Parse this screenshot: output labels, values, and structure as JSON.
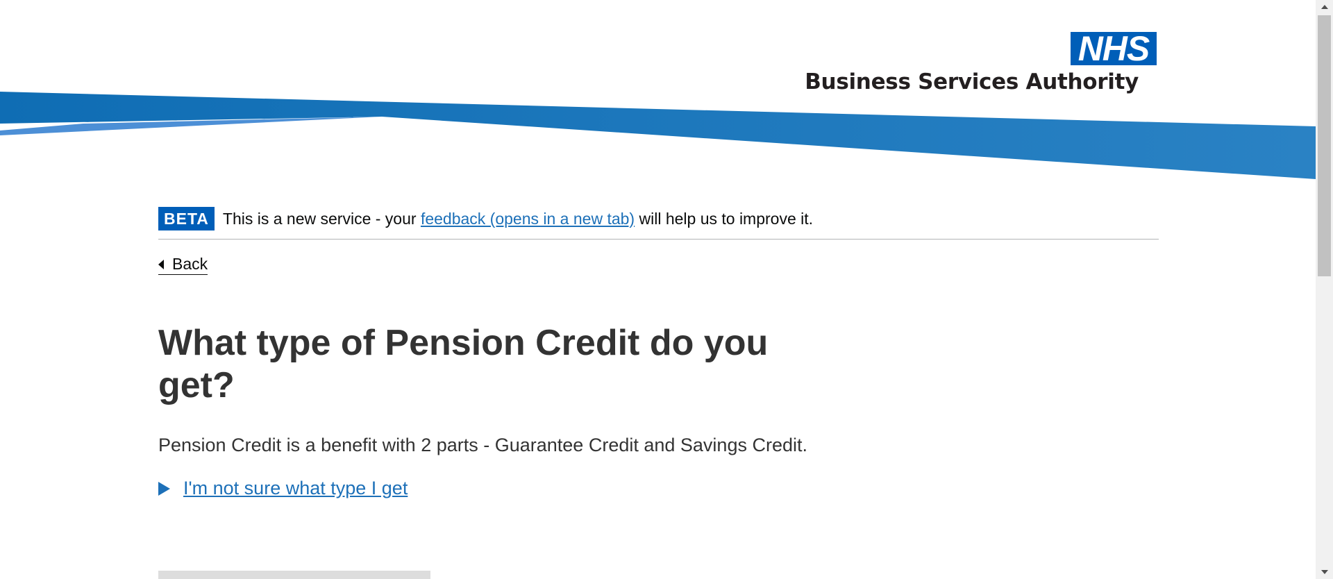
{
  "header": {
    "logo_text": "NHS",
    "org_name": "Business Services Authority",
    "colors": {
      "brand_blue": "#005eb8",
      "swoosh_light": "#4c8fd6",
      "swoosh_mid": "#1a72bb"
    }
  },
  "phase_banner": {
    "tag": "BETA",
    "text_before": "This is a new service - your ",
    "link_text": "feedback (opens in a new tab)",
    "text_after": " will help us to improve it."
  },
  "back_link": {
    "label": "Back",
    "icon": "chevron-left-icon"
  },
  "main": {
    "heading": "What type of Pension Credit do you get?",
    "lead": "Pension Credit is a benefit with 2 parts - Guarantee Credit and Savings Credit.",
    "details_summary": "I'm not sure what type I get",
    "details_icon": "triangle-right-icon"
  },
  "colors": {
    "link": "#1d70b8",
    "text": "#333333",
    "divider": "#b1b4b6"
  }
}
